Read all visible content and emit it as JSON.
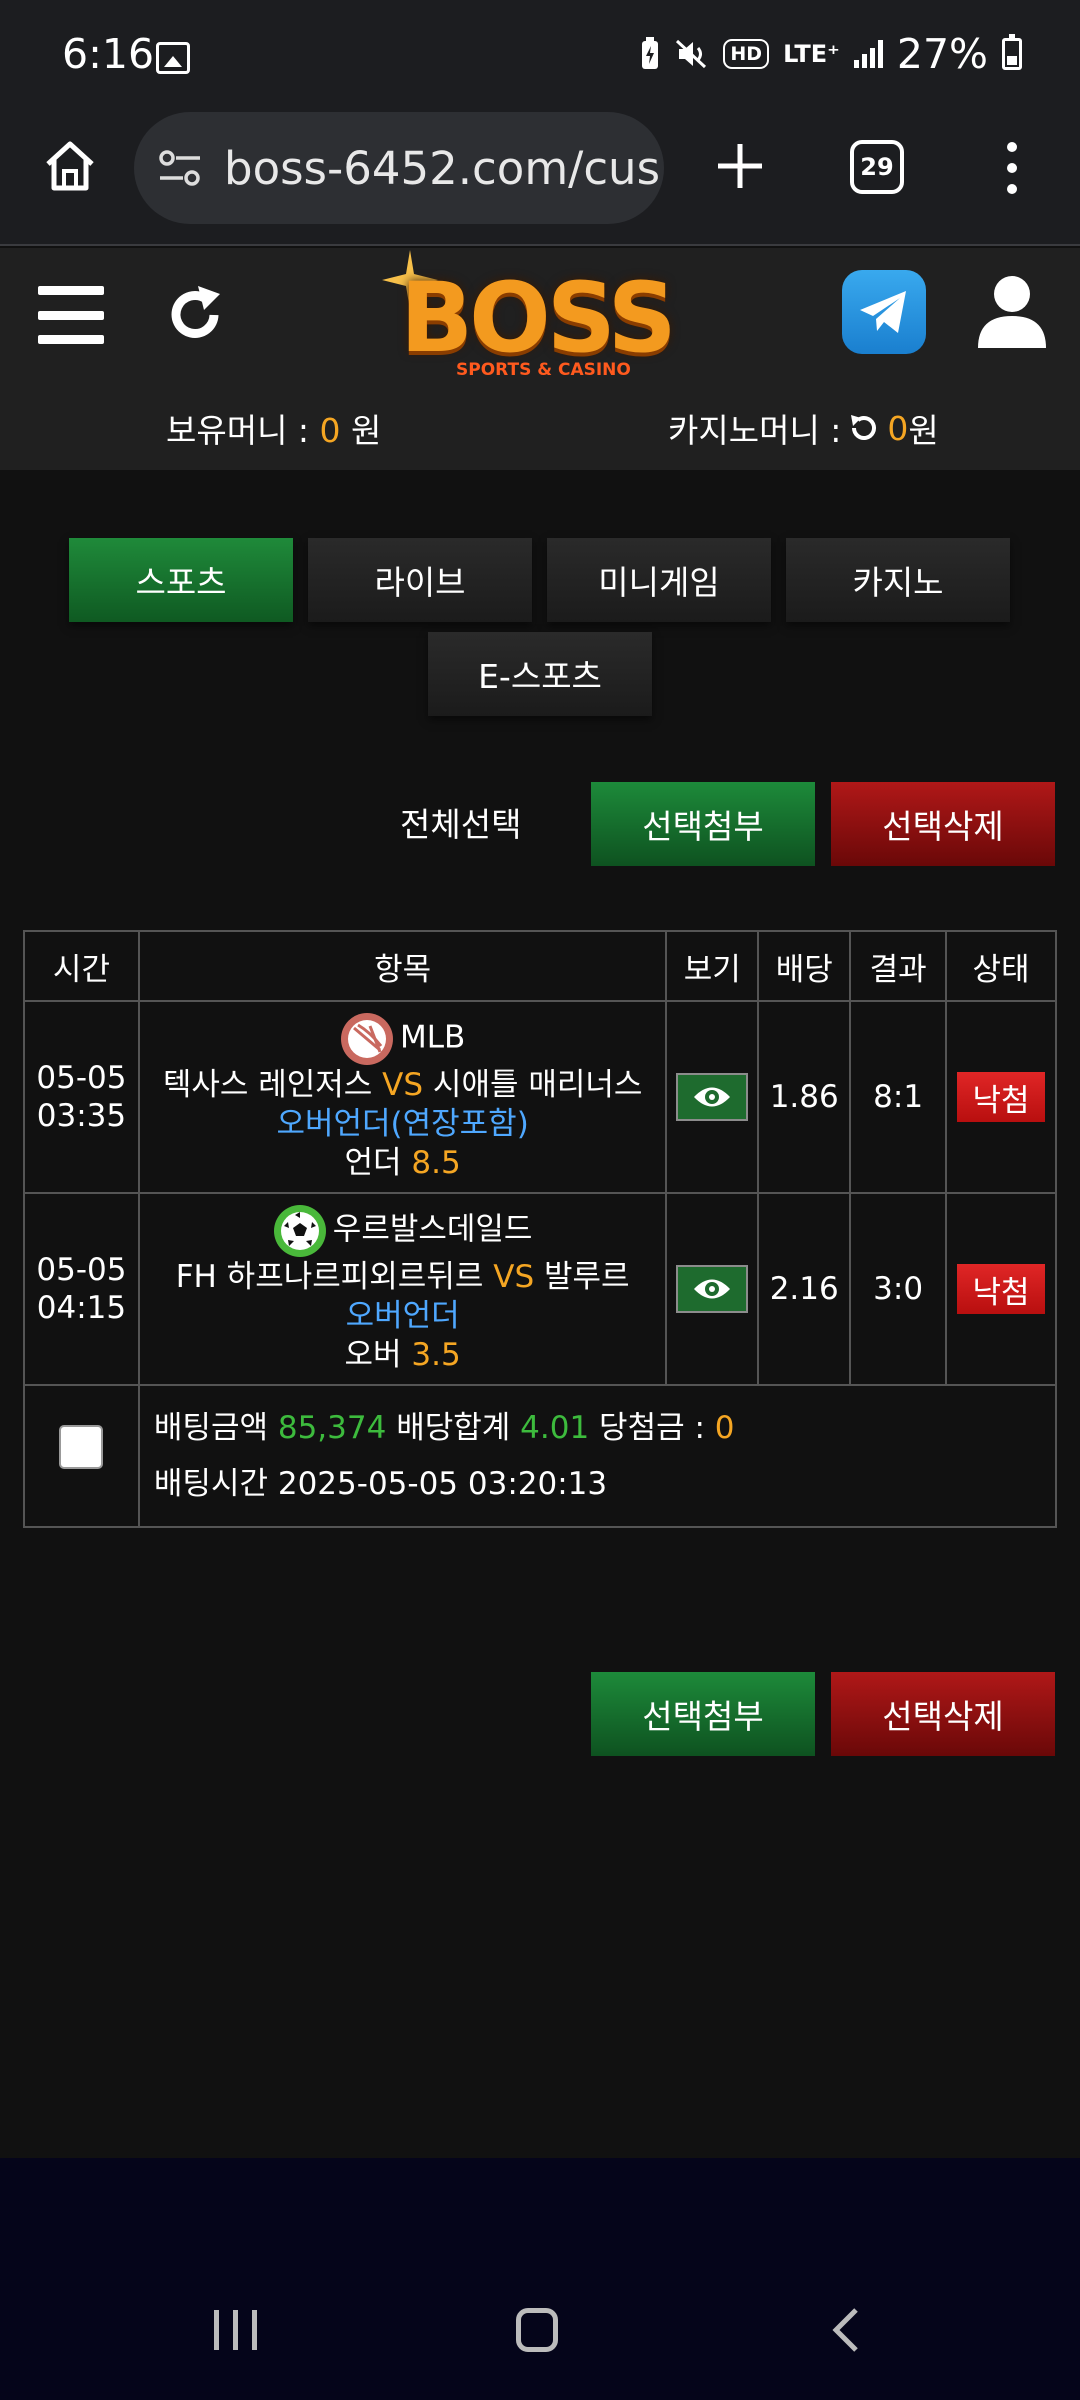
{
  "status_bar": {
    "time": "6:16",
    "battery": "27%",
    "icons": [
      "gallery-icon",
      "battery-saver-icon",
      "mute-icon",
      "hd-icon",
      "lte-icon",
      "signal-icon",
      "battery-icon"
    ],
    "hd": "HD",
    "lte": "LTE⁺"
  },
  "browser": {
    "url": "boss-6452.com/cus",
    "tab_count": "29"
  },
  "header": {
    "logo_text": "BOSS",
    "logo_sub": "SPORTS & CASINO",
    "holding_money_label": "보유머니 : ",
    "holding_money_value": "0",
    "holding_money_unit": " 원",
    "casino_money_label": "카지노머니 : ",
    "casino_money_value": "0",
    "casino_money_unit": " 원"
  },
  "categories": [
    "스포츠",
    "라이브",
    "미니게임",
    "카지노",
    "E-스포츠"
  ],
  "actions": {
    "select_all": "전체선택",
    "attach": "선택첨부",
    "delete": "선택삭제"
  },
  "table": {
    "headers": [
      "시간",
      "항목",
      "보기",
      "배당",
      "결과",
      "상태"
    ],
    "rows": [
      {
        "date": "05-05",
        "time": "03:35",
        "league": "MLB",
        "home": "텍사스 레인저스",
        "vs": "VS",
        "away": "시애틀 매리너스",
        "market": "오버언더(연장포함)",
        "pick_label": "언더",
        "pick_value": "8.5",
        "odds": "1.86",
        "result": "8:1",
        "status": "낙첨"
      },
      {
        "date": "05-05",
        "time": "04:15",
        "league": "우르발스데일드",
        "home": "FH 하프나르피외르뒤르",
        "vs": "VS",
        "away": "발루르",
        "market": "오버언더",
        "pick_label": "오버",
        "pick_value": "3.5",
        "odds": "2.16",
        "result": "3:0",
        "status": "낙첨"
      }
    ],
    "summary": {
      "bet_amount_label": "배팅금액",
      "bet_amount": "85,374",
      "odds_total_label": "배당합계",
      "odds_total": "4.01",
      "win_label": "당첨금 :",
      "win_amount": "0",
      "bet_time_label": "배팅시간",
      "bet_time": "2025-05-05 03:20:13"
    }
  },
  "colors": {
    "accent_orange": "#f5a623",
    "odds_green": "#3dbb3d",
    "market_blue": "#4fa8ff",
    "button_green": "#1d8a3a",
    "button_red": "#b01818"
  }
}
